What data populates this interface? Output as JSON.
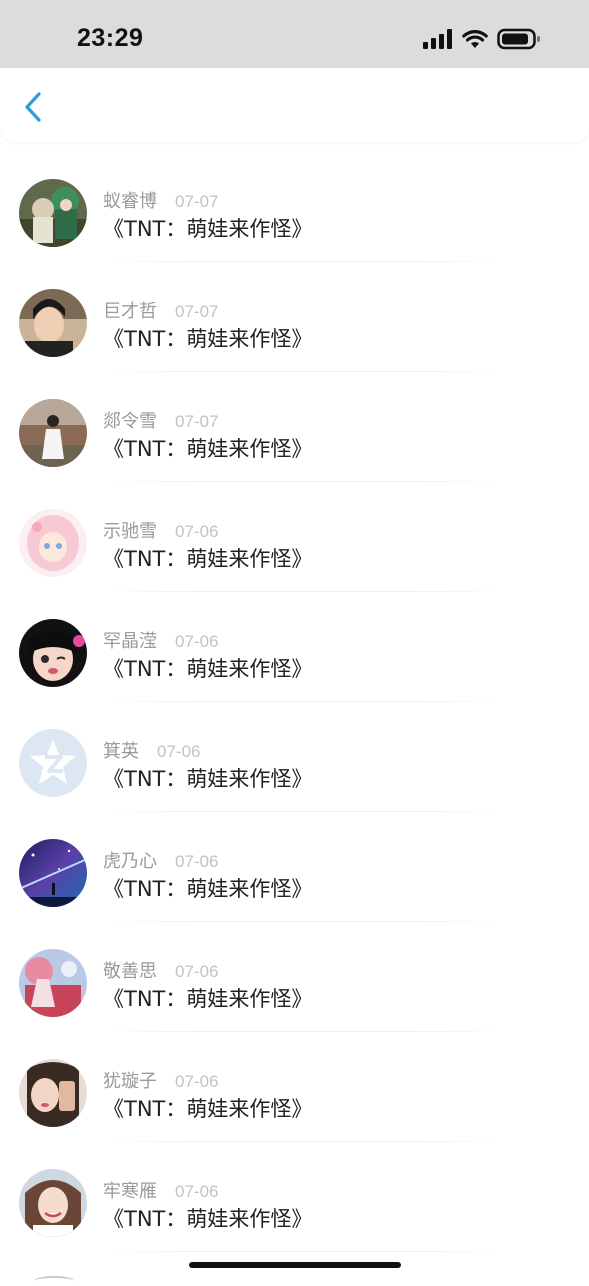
{
  "status_bar": {
    "time": "23:29",
    "icons": [
      "cellular-signal-icon",
      "wifi-icon",
      "battery-icon"
    ]
  },
  "nav": {
    "back_icon": "chevron-left-icon",
    "accent_color": "#2d9cdb"
  },
  "list": {
    "items": [
      {
        "name": "蚁睿博",
        "date": "07-07",
        "title": "《TNT：萌娃来作怪》",
        "avatar": "anime-characters-avatar"
      },
      {
        "name": "巨才哲",
        "date": "07-07",
        "title": "《TNT：萌娃来作怪》",
        "avatar": "young-man-selfie-avatar"
      },
      {
        "name": "郯令雪",
        "date": "07-07",
        "title": "《TNT：萌娃来作怪》",
        "avatar": "girl-white-dress-avatar"
      },
      {
        "name": "示驰雪",
        "date": "07-06",
        "title": "《TNT：萌娃来作怪》",
        "avatar": "anime-pink-hair-girl-avatar"
      },
      {
        "name": "罕晶滢",
        "date": "07-06",
        "title": "《TNT：萌娃来作怪》",
        "avatar": "illustrated-girl-wink-avatar"
      },
      {
        "name": "箕英",
        "date": "07-06",
        "title": "《TNT：萌娃来作怪》",
        "avatar": "default-qzone-avatar"
      },
      {
        "name": "虎乃心",
        "date": "07-06",
        "title": "《TNT：萌娃来作怪》",
        "avatar": "starry-sky-avatar"
      },
      {
        "name": "敬善思",
        "date": "07-06",
        "title": "《TNT：萌娃来作怪》",
        "avatar": "anime-red-scene-avatar"
      },
      {
        "name": "犹璇子",
        "date": "07-06",
        "title": "《TNT：萌娃来作怪》",
        "avatar": "girl-phone-selfie-avatar"
      },
      {
        "name": "牢寒雁",
        "date": "07-06",
        "title": "《TNT：萌娃来作怪》",
        "avatar": "smiling-girl-avatar"
      }
    ]
  }
}
